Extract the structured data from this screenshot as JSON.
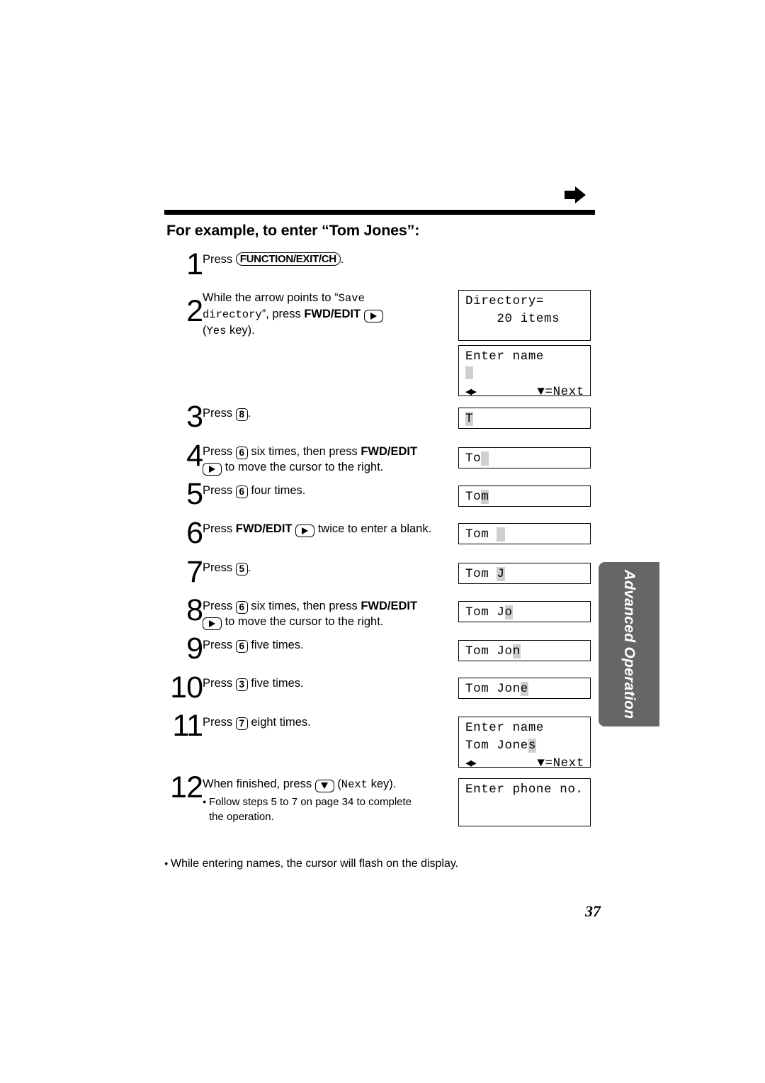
{
  "header": {
    "arrow_icon": "right-arrow-icon",
    "rule": "horizontal-rule"
  },
  "title": "For example, to enter “Tom Jones”:",
  "steps": [
    {
      "number": "1",
      "text_prefix": "Press ",
      "key": "FUNCTION/EXIT/CH",
      "text_suffix": "."
    },
    {
      "number": "2",
      "line1_a": "While the arrow points to “",
      "line1_mono": "Save",
      "line2_mono": "directory",
      "line2_b": "”, press ",
      "line2_bold": "FWD/EDIT",
      "line3_a": "(",
      "line3_mono": "Yes",
      "line3_b": " key)."
    },
    {
      "number": "3",
      "text_prefix": "Press ",
      "keynum": "8",
      "text_suffix": "."
    },
    {
      "number": "4",
      "text_a": "Press ",
      "keynum": "6",
      "text_b": " six times, then press ",
      "bold": "FWD/EDIT",
      "text_c": " to move the cursor to the right."
    },
    {
      "number": "5",
      "text_a": "Press ",
      "keynum": "6",
      "text_b": " four times."
    },
    {
      "number": "6",
      "text_a": "Press ",
      "bold": "FWD/EDIT",
      "text_b": " twice to enter a blank."
    },
    {
      "number": "7",
      "text_a": "Press ",
      "keynum": "5",
      "text_b": "."
    },
    {
      "number": "8",
      "text_a": "Press ",
      "keynum": "6",
      "text_b": " six times, then press ",
      "bold": "FWD/EDIT",
      "text_c": " to move the cursor to the right."
    },
    {
      "number": "9",
      "text_a": "Press ",
      "keynum": "6",
      "text_b": " five times."
    },
    {
      "number": "10",
      "text_a": "Press ",
      "keynum": "3",
      "text_b": " five times."
    },
    {
      "number": "11",
      "text_a": "Press ",
      "keynum": "7",
      "text_b": " eight times."
    },
    {
      "number": "12",
      "text_a": "When finished, press ",
      "text_b": " (",
      "mono": "Next",
      "text_c": " key).",
      "note_line1": "Follow steps 5 to 7 on page 34 to complete",
      "note_line2": "the operation."
    }
  ],
  "displays": {
    "directory": {
      "line1": "Directory=",
      "line2": "    20 items",
      "line3": ""
    },
    "enter_name_blank": {
      "line1": "Enter name",
      "cursor": "block",
      "left_right": "◀▶",
      "next_label": "▼=Next"
    },
    "t": {
      "text": "",
      "cursor_char": "T"
    },
    "to": {
      "text": "To",
      "cursor_char": " "
    },
    "tom": {
      "text": "To",
      "cursor_char": "m"
    },
    "tom_blank": {
      "text": "Tom ",
      "cursor_char": " "
    },
    "tom_j": {
      "text": "Tom ",
      "cursor_char": "J"
    },
    "tom_jo": {
      "text": "Tom J",
      "cursor_char": "o"
    },
    "tom_jon": {
      "text": "Tom Jo",
      "cursor_char": "n"
    },
    "tom_jone": {
      "text": "Tom Jon",
      "cursor_char": "e"
    },
    "enter_name_full": {
      "line1": "Enter name",
      "line2_text": "Tom Jone",
      "line2_cursor": "s",
      "left_right": "◀▶",
      "next_label": "▼=Next"
    },
    "enter_phone": {
      "line1": "Enter phone no."
    }
  },
  "side_tab": {
    "label": "Advanced Operation",
    "color": "#666666"
  },
  "footnote": "While entering names, the cursor will flash on the display.",
  "page_number": "37"
}
